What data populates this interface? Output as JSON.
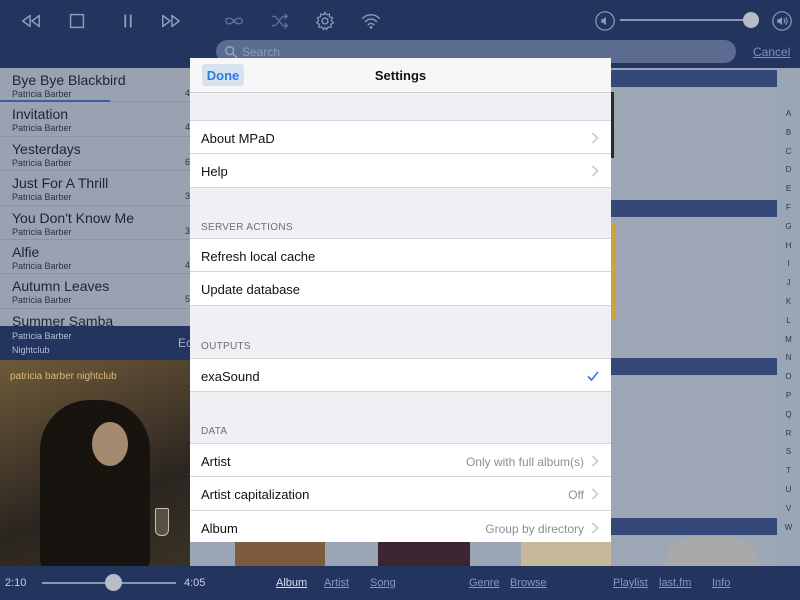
{
  "colors": {
    "toolbar_bg": "#23355f",
    "accent_blue": "#2a7be4",
    "modal_bg": "#efeff4"
  },
  "toolbar": {
    "icons": [
      "rewind-icon",
      "stop-icon",
      "pause-icon",
      "fast-forward-icon",
      "repeat-icon",
      "shuffle-icon",
      "gear-icon",
      "wifi-icon",
      "volume-low-icon",
      "volume-high-icon"
    ],
    "volume_level": 0.97
  },
  "search": {
    "placeholder": "Search",
    "cancel_label": "Cancel"
  },
  "queue": {
    "items": [
      {
        "title": "Bye Bye Blackbird",
        "artist": "Patricia Barber",
        "duration": "4"
      },
      {
        "title": "Invitation",
        "artist": "Patricia Barber",
        "duration": "4"
      },
      {
        "title": "Yesterdays",
        "artist": "Patricia Barber",
        "duration": "6"
      },
      {
        "title": "Just For A Thrill",
        "artist": "Patricia Barber",
        "duration": "3"
      },
      {
        "title": "You Don't Know Me",
        "artist": "Patricia Barber",
        "duration": "3"
      },
      {
        "title": "Alfie",
        "artist": "Patricia Barber",
        "duration": "4"
      },
      {
        "title": "Autumn Leaves",
        "artist": "Patricia Barber",
        "duration": "5"
      },
      {
        "title": "Summer Samba",
        "artist": "",
        "duration": ""
      }
    ],
    "current_progress": 0.58
  },
  "now_playing": {
    "artist": "Patricia Barber",
    "album": "Nightclub",
    "partial_label": "Ec",
    "cover_text": "patricia barber nightclub"
  },
  "settings": {
    "title": "Settings",
    "done_label": "Done",
    "general": [
      {
        "label": "About MPaD"
      },
      {
        "label": "Help"
      }
    ],
    "server_actions_header": "SERVER ACTIONS",
    "server_actions": [
      {
        "label": "Refresh local cache"
      },
      {
        "label": "Update database"
      }
    ],
    "outputs_header": "OUTPUTS",
    "outputs": [
      {
        "label": "exaSound",
        "checked": true
      }
    ],
    "data_header": "DATA",
    "data": [
      {
        "label": "Artist",
        "value": "Only with full album(s)"
      },
      {
        "label": "Artist capitalization",
        "value": "Off"
      },
      {
        "label": "Album",
        "value": "Group by directory"
      }
    ]
  },
  "alphabet": [
    "A",
    "B",
    "C",
    "D",
    "E",
    "F",
    "G",
    "H",
    "I",
    "J",
    "K",
    "L",
    "M",
    "N",
    "O",
    "P",
    "Q",
    "R",
    "S",
    "T",
    "U",
    "V",
    "W"
  ],
  "bottom": {
    "elapsed": "2:10",
    "total": "4:05",
    "progress": 0.53,
    "tabs": [
      "Album",
      "Artist",
      "Song",
      "Genre",
      "Browse",
      "Playlist",
      "last.fm",
      "Info"
    ],
    "active_tab": "Album"
  }
}
